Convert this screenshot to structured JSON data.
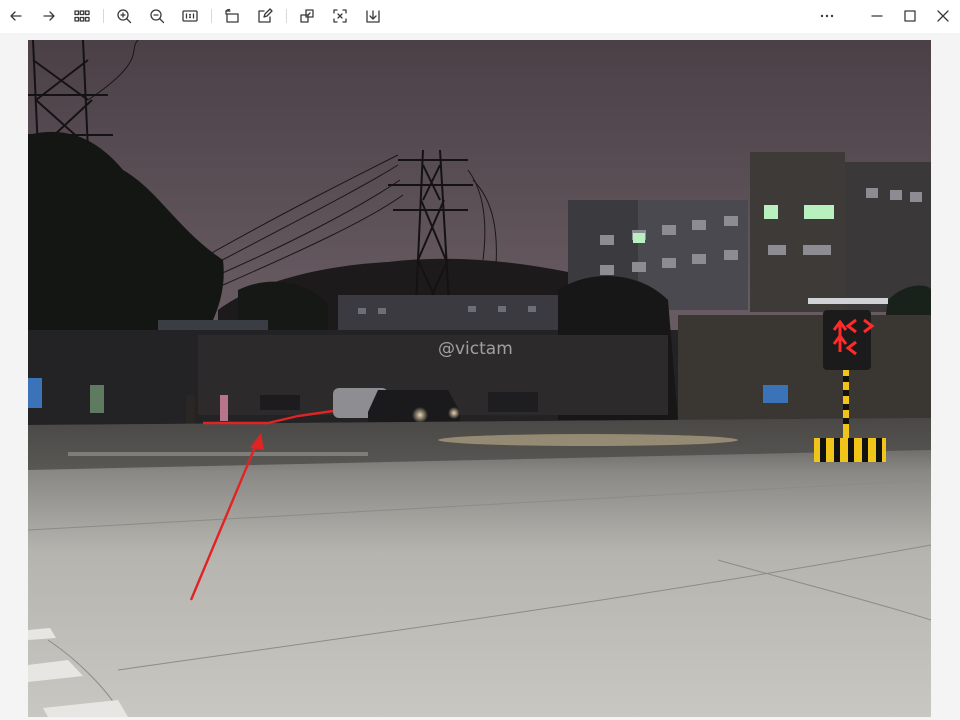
{
  "toolbar": {
    "left_buttons": [
      {
        "name": "back-button",
        "icon": "arrow-left-icon"
      },
      {
        "name": "forward-button",
        "icon": "arrow-right-icon"
      },
      {
        "name": "thumbnails-button",
        "icon": "grid-icon"
      },
      {
        "name": "zoom-in-button",
        "icon": "zoom-in-icon"
      },
      {
        "name": "zoom-out-button",
        "icon": "zoom-out-icon"
      },
      {
        "name": "actual-size-button",
        "icon": "actual-size-icon",
        "label": "1:1"
      },
      {
        "name": "rotate-button",
        "icon": "rotate-icon"
      },
      {
        "name": "edit-button",
        "icon": "edit-icon"
      },
      {
        "name": "crop-button",
        "icon": "crop-icon"
      },
      {
        "name": "fit-screen-button",
        "icon": "fit-screen-icon"
      },
      {
        "name": "download-button",
        "icon": "download-icon"
      }
    ],
    "right_buttons": [
      {
        "name": "more-button",
        "icon": "more-dots-icon"
      },
      {
        "name": "minimize-button",
        "icon": "minimize-icon"
      },
      {
        "name": "maximize-button",
        "icon": "maximize-icon"
      },
      {
        "name": "close-button",
        "icon": "close-icon"
      }
    ]
  },
  "photo": {
    "watermark": "@victam",
    "description_colors": {
      "sky": "#5e5258",
      "road": "#b9b7b2",
      "annotation": "#e02424",
      "signal": "#ff2a2a"
    }
  }
}
